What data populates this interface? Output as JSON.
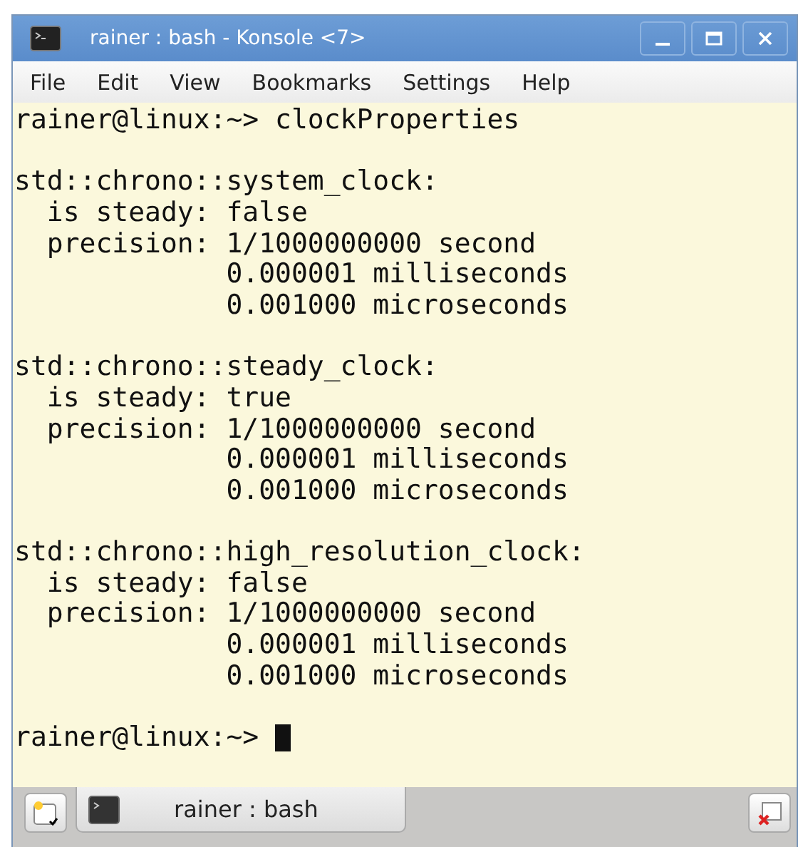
{
  "window": {
    "title": "rainer : bash - Konsole <7>"
  },
  "menu": [
    "File",
    "Edit",
    "View",
    "Bookmarks",
    "Settings",
    "Help"
  ],
  "terminal": {
    "blocks": [
      {
        "lines": [
          "rainer@linux:~> clockProperties"
        ]
      },
      {
        "lines": [
          "std::chrono::system_clock:",
          "  is steady: false",
          "  precision: 1/1000000000 second",
          "             0.000001 milliseconds",
          "             0.001000 microseconds"
        ]
      },
      {
        "lines": [
          "std::chrono::steady_clock:",
          "  is steady: true",
          "  precision: 1/1000000000 second",
          "             0.000001 milliseconds",
          "             0.001000 microseconds"
        ]
      },
      {
        "lines": [
          "std::chrono::high_resolution_clock:",
          "  is steady: false",
          "  precision: 1/1000000000 second",
          "             0.000001 milliseconds",
          "             0.001000 microseconds"
        ]
      }
    ],
    "prompt": "rainer@linux:~> ",
    "cursor": true
  },
  "tabs": [
    {
      "label": "rainer : bash",
      "selected": true
    }
  ]
}
